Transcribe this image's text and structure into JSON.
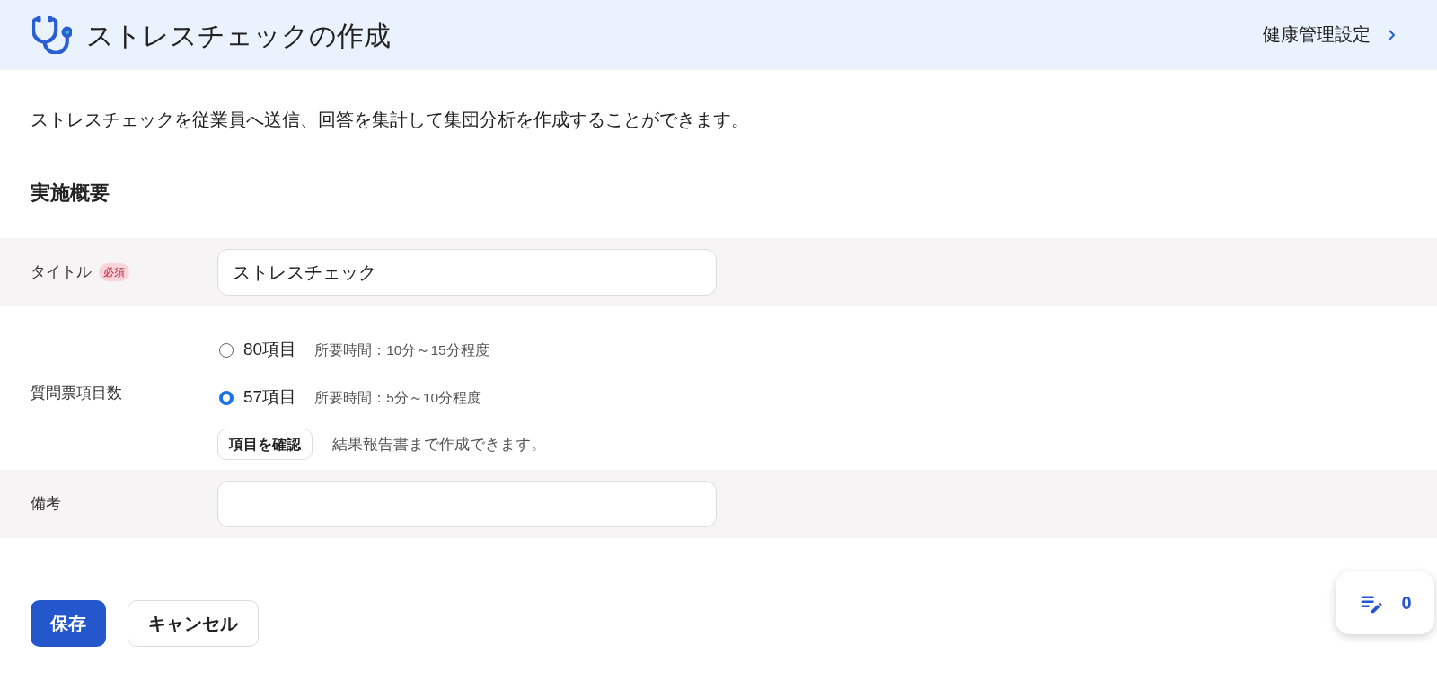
{
  "header": {
    "title": "ストレスチェックの作成",
    "link": "健康管理設定"
  },
  "description": "ストレスチェックを従業員へ送信、回答を集計して集団分析を作成することができます。",
  "section_title": "実施概要",
  "form": {
    "rows": [
      {
        "kind": "text",
        "label": "タイトル",
        "required_badge": "必須",
        "value": "ストレスチェック"
      },
      {
        "kind": "radio",
        "label": "質問票項目数",
        "options": [
          {
            "label": "80項目",
            "note": "所要時間：10分～15分程度",
            "selected": false
          },
          {
            "label": "57項目",
            "note": "所要時間：5分～10分程度",
            "selected": true
          }
        ],
        "button": "項目を確認",
        "hint": "結果報告書まで作成できます。"
      },
      {
        "kind": "text",
        "label": "備考"
      }
    ]
  },
  "actions": [
    {
      "kind": "primary",
      "label": "保存"
    },
    {
      "kind": "secondary",
      "label": "キャンセル"
    }
  ],
  "floating_counter": {
    "count": "0"
  }
}
